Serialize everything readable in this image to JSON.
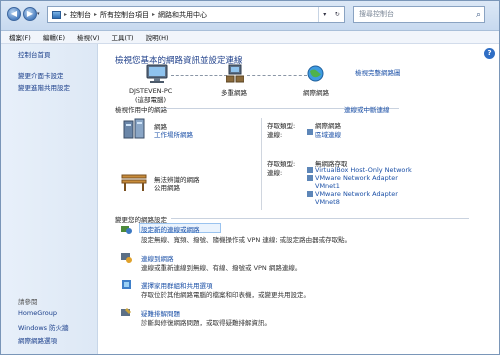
{
  "addressbar": {
    "crumbs": [
      "控制台",
      "所有控制台項目",
      "網路和共用中心"
    ],
    "search_placeholder": "搜尋控制台"
  },
  "menu": [
    "檔案(F)",
    "編輯(E)",
    "檢視(V)",
    "工具(T)",
    "說明(H)"
  ],
  "sidebar": {
    "home": "控制台首頁",
    "links": [
      "變更介面卡設定",
      "變更進階共用設定"
    ],
    "see_also_title": "請參閱",
    "see_also": [
      "HomeGroup",
      "Windows 防火牆",
      "網際網路選項"
    ]
  },
  "main": {
    "title": "檢視您基本的網路資訊並設定連線",
    "full_map_link": "檢視完整網路圖",
    "map": {
      "pc_name": "DJSTEVEN-PC",
      "pc_sub": "(這部電腦)",
      "multi": "多重網路",
      "internet": "網際網路"
    },
    "active_header": "檢視作用中的網路",
    "connect_disconnect": "連線或中斷連線",
    "net1": {
      "name": "網路",
      "type_link": "工作場所網路",
      "access_label": "存取類型:",
      "access_value": "網際網路",
      "conn_label": "連線:",
      "conn_value": "區域連線"
    },
    "net2": {
      "name": "無法辨識的網路",
      "type": "公用網路",
      "access_label": "存取類型:",
      "access_value": "無網路存取",
      "conn_label": "連線:",
      "conns": [
        "VirtualBox Host-Only Network",
        "VMware Network Adapter",
        "VMnet1",
        "VMware Network Adapter",
        "VMnet8"
      ]
    },
    "change_header": "變更您的網路設定",
    "tasks": [
      {
        "link": "設定新的連線或網路",
        "desc": "設定無線、寬頻、撥號、隨機操作或 VPN 連線; 或設定路由器或存取點。"
      },
      {
        "link": "連線到網路",
        "desc": "連線或重新連線到無線、有線、撥號或 VPN 網路連線。"
      },
      {
        "link": "選擇家用群組和共用選項",
        "desc": "存取位於其他網路電腦的檔案和印表機，或變更共用設定。"
      },
      {
        "link": "疑難排解問題",
        "desc": "診斷與修復網路問題，或取得疑難排解資訊。"
      }
    ]
  }
}
